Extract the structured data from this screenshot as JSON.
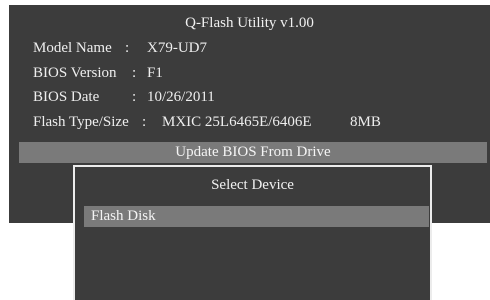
{
  "window": {
    "title": "Q-Flash Utility v1.00"
  },
  "info": [
    {
      "label": "Model Name",
      "separator": ":",
      "value": "X79-UD7"
    },
    {
      "label": "BIOS Version",
      "separator": ":",
      "value": "F1"
    },
    {
      "label": "BIOS Date",
      "separator": ":",
      "value": "10/26/2011"
    },
    {
      "label": "Flash Type/Size",
      "separator": ":",
      "value": "MXIC 25L6465E/6406E",
      "extra": "8MB"
    }
  ],
  "action_bar": {
    "label": "Update BIOS From Drive"
  },
  "dialog": {
    "title": "Select Device",
    "devices": [
      {
        "label": "Flash Disk",
        "selected": true
      }
    ]
  },
  "colors": {
    "panel_bg": "#3c3c3c",
    "highlight_bg": "#7a7a7a",
    "text": "#f2f2f2",
    "dialog_border": "#ececec"
  }
}
